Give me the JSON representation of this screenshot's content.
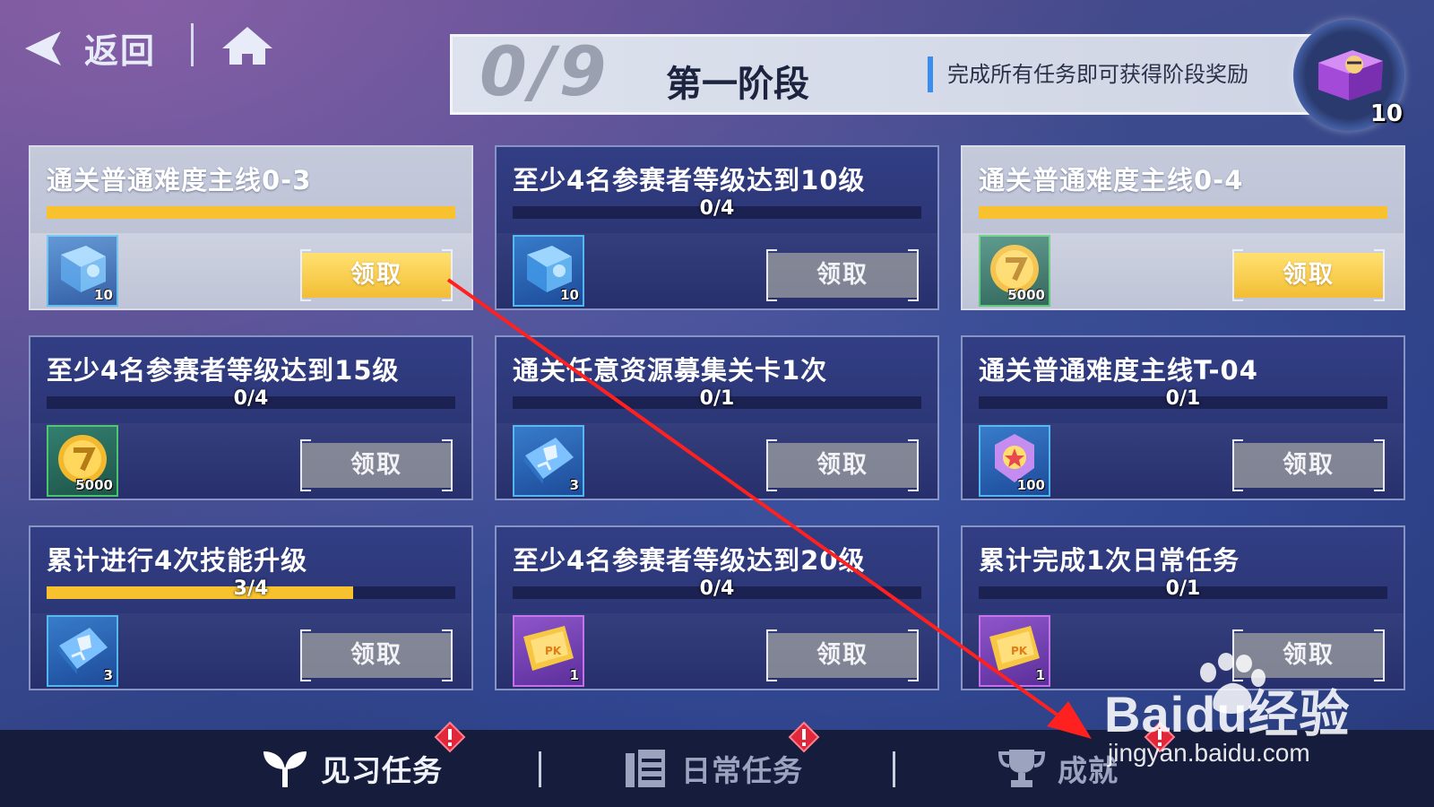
{
  "header": {
    "back_label": "返回",
    "stage_count": "0/9",
    "stage_name": "第一阶段",
    "stage_hint": "完成所有任务即可获得阶段奖励",
    "stage_reward_count": "10"
  },
  "tasks": [
    {
      "title": "通关普通难度主线0-3",
      "progress_text": "",
      "progress": 1.0,
      "completed": true,
      "item_icon": "book-icon",
      "item_count": "10",
      "item_color": "blue",
      "claim_label": "领取"
    },
    {
      "title": "至少4名参赛者等级达到10级",
      "progress_text": "0/4",
      "progress": 0,
      "completed": false,
      "item_icon": "book-icon",
      "item_count": "10",
      "item_color": "blue",
      "claim_label": "领取"
    },
    {
      "title": "通关普通难度主线0-4",
      "progress_text": "",
      "progress": 1.0,
      "completed": true,
      "item_icon": "coin-icon",
      "item_count": "5000",
      "item_color": "green",
      "claim_label": "领取"
    },
    {
      "title": "至少4名参赛者等级达到15级",
      "progress_text": "0/4",
      "progress": 0,
      "completed": false,
      "item_icon": "coin-icon",
      "item_count": "5000",
      "item_color": "green",
      "claim_label": "领取"
    },
    {
      "title": "通关任意资源募集关卡1次",
      "progress_text": "0/1",
      "progress": 0,
      "completed": false,
      "item_icon": "skill-book-icon",
      "item_count": "3",
      "item_color": "blue",
      "claim_label": "领取"
    },
    {
      "title": "通关普通难度主线T-04",
      "progress_text": "0/1",
      "progress": 0,
      "completed": false,
      "item_icon": "badge-icon",
      "item_count": "100",
      "item_color": "blue",
      "claim_label": "领取"
    },
    {
      "title": "累计进行4次技能升级",
      "progress_text": "3/4",
      "progress": 0.75,
      "completed": false,
      "item_icon": "skill-book-icon",
      "item_count": "3",
      "item_color": "blue",
      "claim_label": "领取"
    },
    {
      "title": "至少4名参赛者等级达到20级",
      "progress_text": "0/4",
      "progress": 0,
      "completed": false,
      "item_icon": "ticket-icon",
      "item_count": "1",
      "item_color": "purple",
      "claim_label": "领取"
    },
    {
      "title": "累计完成1次日常任务",
      "progress_text": "0/1",
      "progress": 0,
      "completed": false,
      "item_icon": "ticket-icon",
      "item_count": "1",
      "item_color": "purple",
      "claim_label": "领取"
    }
  ],
  "bottom_nav": {
    "tabs": [
      {
        "label": "见习任务",
        "icon": "sprout-icon",
        "active": true,
        "alert": true
      },
      {
        "label": "日常任务",
        "icon": "calendar-icon",
        "active": false,
        "alert": true
      },
      {
        "label": "成就",
        "icon": "trophy-icon",
        "active": false,
        "alert": true
      }
    ]
  },
  "watermark": {
    "brand": "Baidu经验",
    "url": "jingyan.baidu.com"
  },
  "colors": {
    "accent_yellow": "#f7c22e",
    "annotation_arrow": "#ff2020",
    "alert_red": "#e0283a"
  }
}
